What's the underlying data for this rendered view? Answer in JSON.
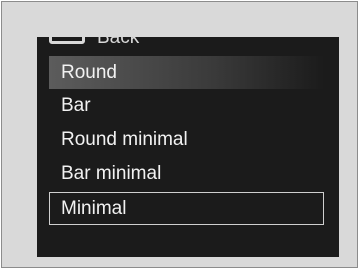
{
  "menu": {
    "back_label": "Back",
    "items": [
      {
        "label": "Round",
        "state": "highlighted"
      },
      {
        "label": "Bar",
        "state": "normal"
      },
      {
        "label": "Round minimal",
        "state": "normal"
      },
      {
        "label": "Bar minimal",
        "state": "normal"
      },
      {
        "label": "Minimal",
        "state": "selected"
      }
    ]
  },
  "colors": {
    "screen_background": "#1b1b1b",
    "text": "#f2f2f2",
    "highlight": "#5c5c5c",
    "selection_border": "#cfcfcf"
  }
}
